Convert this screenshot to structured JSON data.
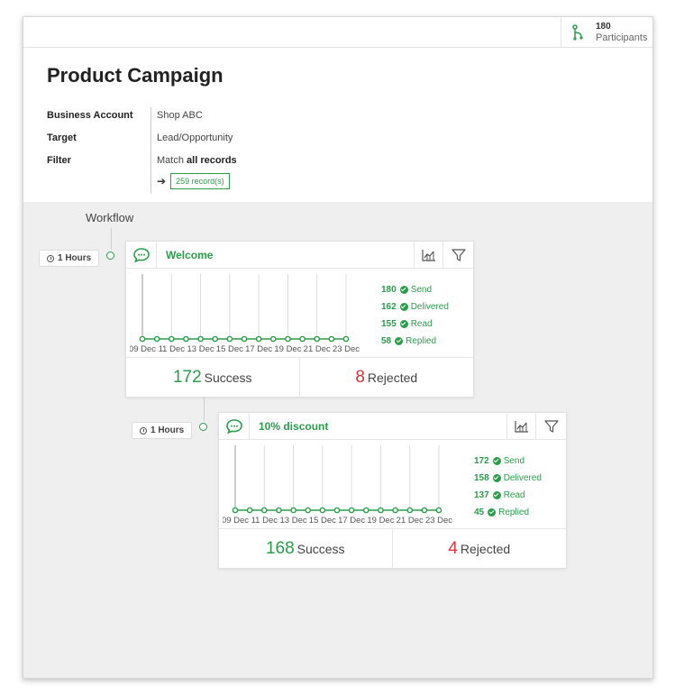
{
  "header": {
    "participants_count": "180",
    "participants_label": "Participants"
  },
  "campaign": {
    "title": "Product Campaign",
    "business_account_label": "Business Account",
    "business_account_value": "Shop ABC",
    "target_label": "Target",
    "target_value": "Lead/Opportunity",
    "filter_label": "Filter",
    "filter_prefix": "Match",
    "filter_value": "all records",
    "records_button": "259 record(s)"
  },
  "workflow": {
    "title": "Workflow",
    "steps": [
      {
        "delay": "1 Hours",
        "name": "Welcome",
        "stats": [
          {
            "num": "180",
            "label": "Send"
          },
          {
            "num": "162",
            "label": "Delivered"
          },
          {
            "num": "155",
            "label": "Read"
          },
          {
            "num": "58",
            "label": "Replied"
          }
        ],
        "success_count": "172",
        "success_label": "Success",
        "rejected_count": "8",
        "rejected_label": "Rejected",
        "chart_data": {
          "type": "line",
          "x_tick_labels": [
            "09 Dec",
            "11 Dec",
            "13 Dec",
            "15 Dec",
            "17 Dec",
            "19 Dec",
            "21 Dec",
            "23 Dec"
          ],
          "points": 15,
          "values": [
            0,
            0,
            0,
            0,
            0,
            0,
            0,
            0,
            0,
            0,
            0,
            0,
            0,
            0,
            0
          ],
          "series_color": "#2a9d4a"
        }
      },
      {
        "delay": "1 Hours",
        "name": "10% discount",
        "stats": [
          {
            "num": "172",
            "label": "Send"
          },
          {
            "num": "158",
            "label": "Delivered"
          },
          {
            "num": "137",
            "label": "Read"
          },
          {
            "num": "45",
            "label": "Replied"
          }
        ],
        "success_count": "168",
        "success_label": "Success",
        "rejected_count": "4",
        "rejected_label": "Rejected",
        "chart_data": {
          "type": "line",
          "x_tick_labels": [
            "09 Dec",
            "11 Dec",
            "13 Dec",
            "15 Dec",
            "17 Dec",
            "19 Dec",
            "21 Dec",
            "23 Dec"
          ],
          "points": 15,
          "values": [
            0,
            0,
            0,
            0,
            0,
            0,
            0,
            0,
            0,
            0,
            0,
            0,
            0,
            0,
            0
          ],
          "series_color": "#2a9d4a"
        }
      }
    ]
  },
  "colors": {
    "accent": "#2a9d4a",
    "rejected": "#d9343c"
  }
}
